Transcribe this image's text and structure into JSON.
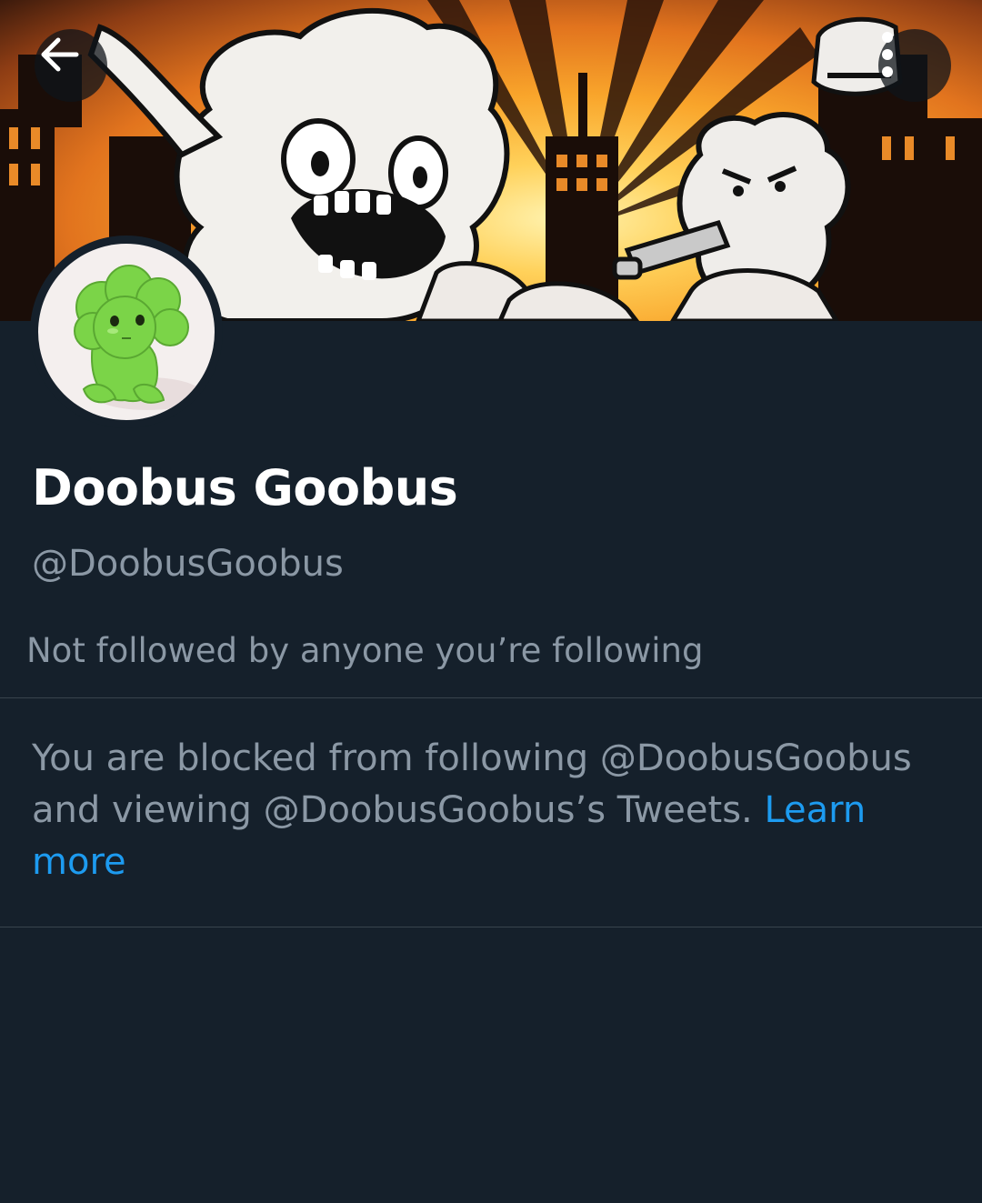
{
  "header": {
    "banner_description": "",
    "back_icon": "arrow-left-icon",
    "more_icon": "more-vertical-icon"
  },
  "profile": {
    "display_name": "Doobus Goobus",
    "handle": "@DoobusGoobus",
    "followers_you_know": "Not followed by anyone you’re following"
  },
  "blocked_notice": {
    "text": "You are blocked from following @DoobusGoobus and viewing @DoobusGoobus’s Tweets. ",
    "link_label": "Learn more"
  },
  "colors": {
    "background": "#15202b",
    "text_primary": "#ffffff",
    "text_secondary": "#8b98a5",
    "link": "#1d9bf0",
    "divider": "#38444d"
  }
}
